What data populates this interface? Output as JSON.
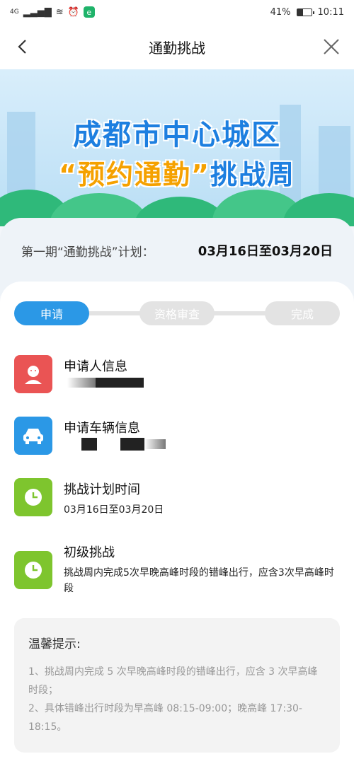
{
  "status_bar": {
    "signal_label": "4G",
    "app_badge": "e",
    "battery_percent": "41%",
    "battery_level": 0.41,
    "time": "10:11"
  },
  "nav": {
    "title": "通勤挑战",
    "back_icon": "chevron-left-icon",
    "close_icon": "close-icon"
  },
  "banner": {
    "line1": "成都市中心城区",
    "line2_highlight": "“预约通勤”",
    "line2_rest": "挑战周"
  },
  "plan": {
    "label": "第一期“通勤挑战”计划：",
    "range": "03月16日至03月20日"
  },
  "steps": [
    {
      "label": "申请",
      "state": "active"
    },
    {
      "label": "资格审查",
      "state": "inactive"
    },
    {
      "label": "完成",
      "state": "inactive"
    }
  ],
  "items": [
    {
      "title": "申请人信息",
      "icon": "person-icon",
      "color": "#ea5454"
    },
    {
      "title": "申请车辆信息",
      "icon": "car-icon",
      "color": "#2b98e6"
    },
    {
      "title": "挑战计划时间",
      "subtitle": "03月16日至03月20日",
      "icon": "clock-icon",
      "color": "#7ec52e"
    },
    {
      "title": "初级挑战",
      "subtitle": "挑战周内完成5次早晚高峰时段的错峰出行，应含3次早高峰时段",
      "icon": "clock-icon",
      "color": "#7ec52e"
    }
  ],
  "tips": {
    "title": "温馨提示:",
    "lines": [
      "1、挑战周内完成 5 次早晚高峰时段的错峰出行，应含 3 次早高峰时段；",
      "2、具体错峰出行时段为早高峰 08:15-09:00；晚高峰 17:30-18:15。"
    ]
  },
  "colors": {
    "accent": "#2b98e6",
    "red": "#ea5454",
    "green": "#7ec52e"
  }
}
